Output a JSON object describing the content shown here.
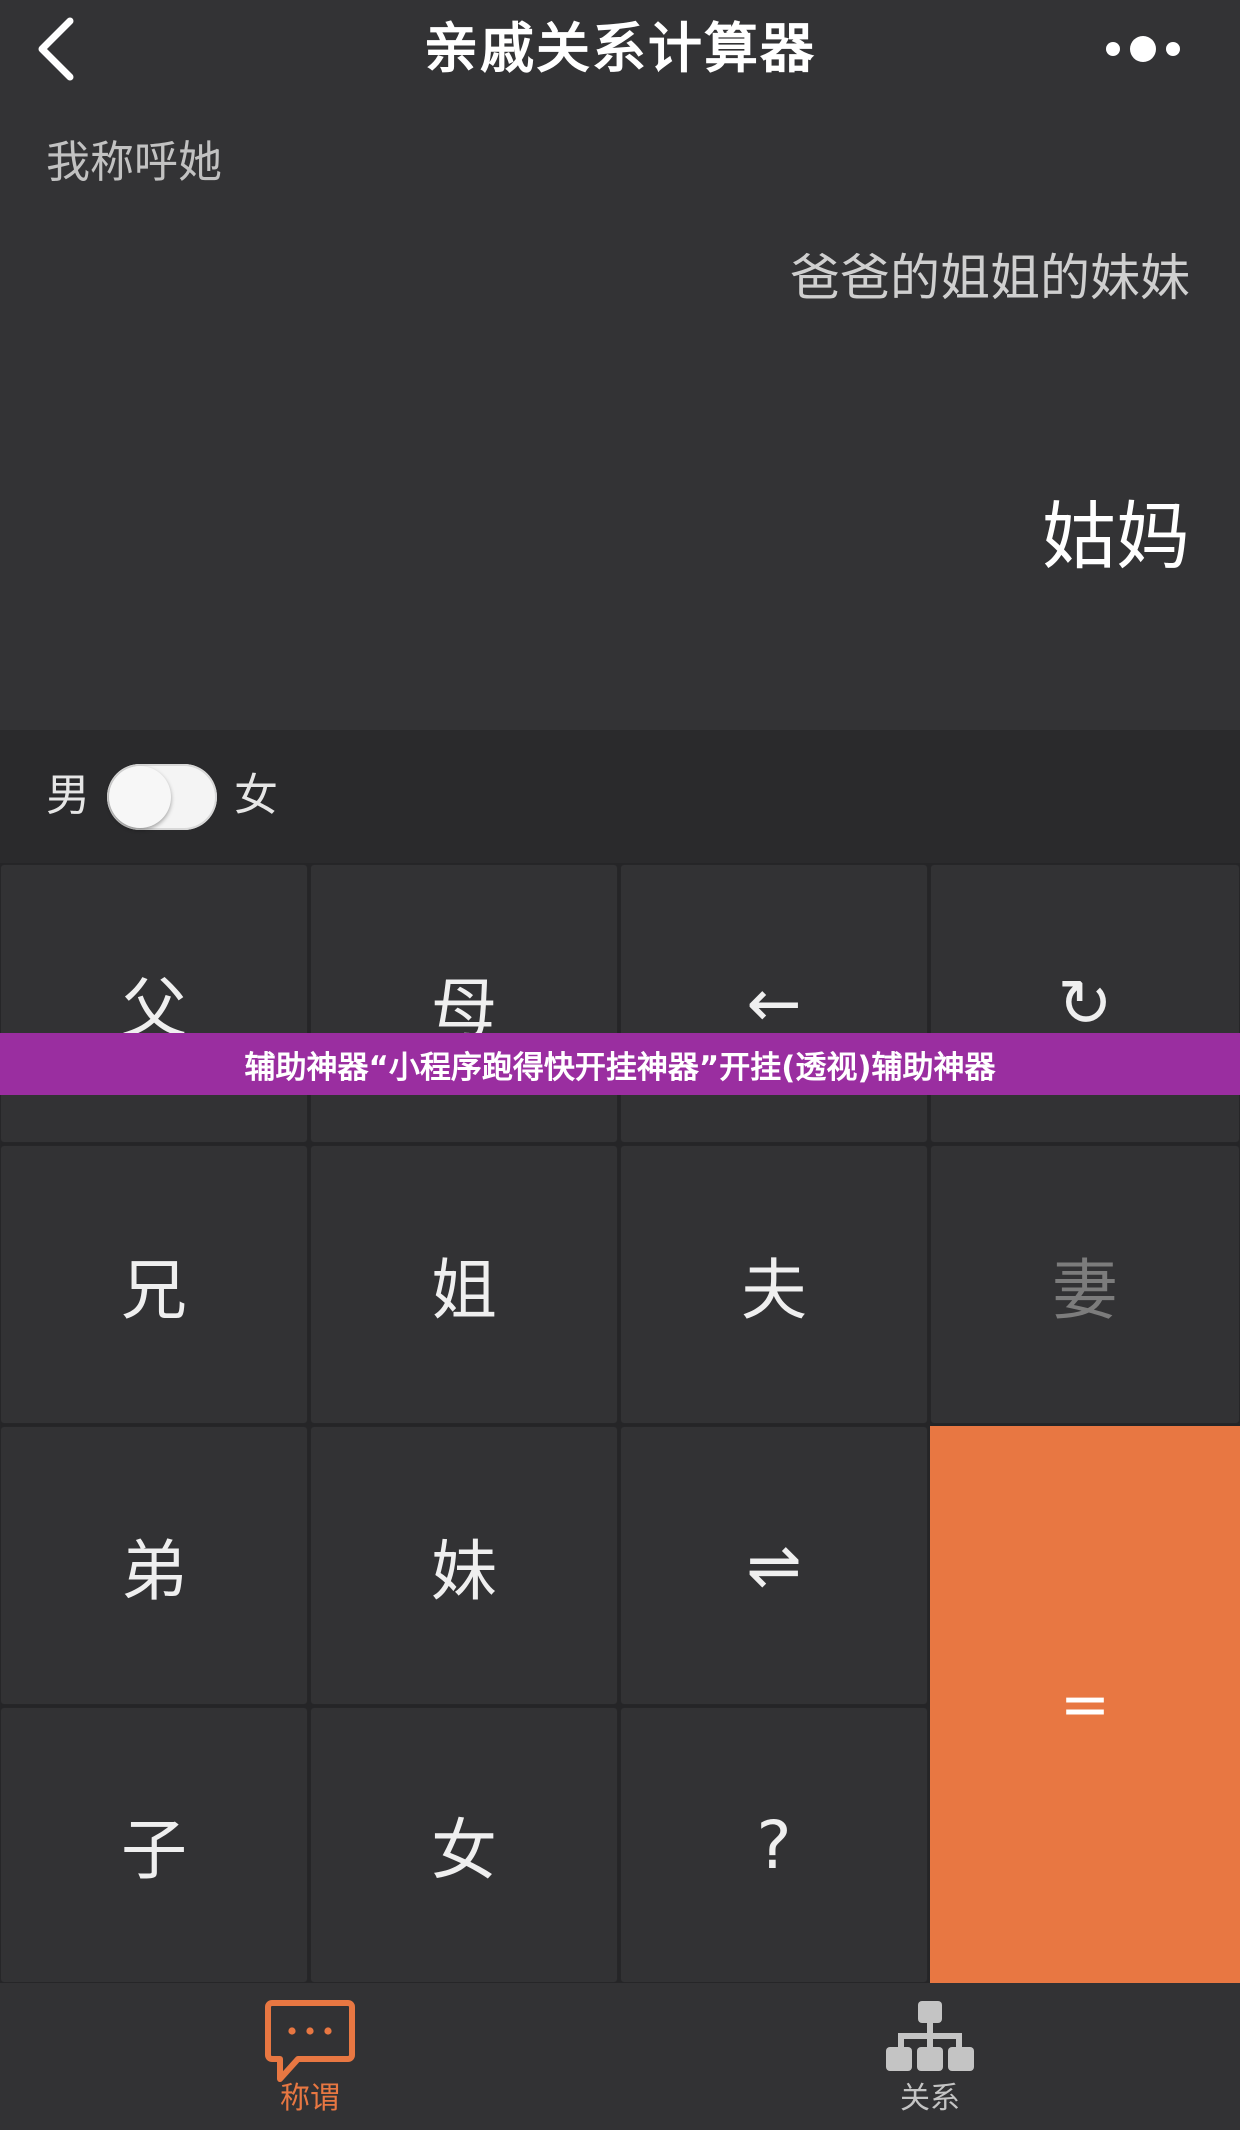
{
  "header": {
    "title": "亲戚关系计算器",
    "back_icon": "chevron-left-icon",
    "more_icon": "more-dots-icon"
  },
  "display": {
    "call_label": "我称呼她",
    "expression": "爸爸的姐姐的妹妹",
    "result": "姑妈"
  },
  "gender": {
    "male_label": "男",
    "female_label": "女",
    "selected": "男"
  },
  "keypad": {
    "keys": [
      {
        "label": "父"
      },
      {
        "label": "母"
      },
      {
        "label": "←"
      },
      {
        "label": "↻"
      },
      {
        "label": "兄"
      },
      {
        "label": "姐"
      },
      {
        "label": "夫"
      },
      {
        "label": "妻",
        "disabled": true
      },
      {
        "label": "弟"
      },
      {
        "label": "妹"
      },
      {
        "label": "⇌"
      },
      {
        "label": "子"
      },
      {
        "label": "女"
      },
      {
        "label": "?"
      }
    ],
    "equals_label": "="
  },
  "banner": {
    "text": "辅助神器“小程序跑得快开挂神器”开挂(透视)辅助神器"
  },
  "tabbar": {
    "tabs": [
      {
        "label": "称谓",
        "icon": "chat-bubble-icon",
        "active": true
      },
      {
        "label": "关系",
        "icon": "org-chart-icon",
        "active": false
      }
    ]
  },
  "colors": {
    "accent": "#e87742",
    "background": "#333335",
    "banner": "#9a2ea0"
  }
}
